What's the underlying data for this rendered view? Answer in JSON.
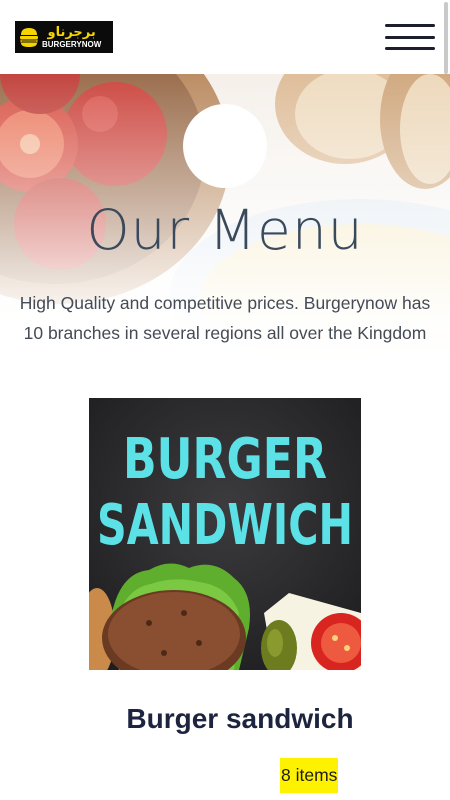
{
  "header": {
    "logo": {
      "arabic": "برجرناو",
      "english": "BURGERYNOW"
    },
    "menu_icon": "hamburger-menu-icon"
  },
  "hero": {
    "title": "Our Menu",
    "description": "High Quality and competitive prices. Burgerynow has 10 branches in several regions all over the Kingdom"
  },
  "category": {
    "image_text_line1": "BURGER",
    "image_text_line2": "SANDWICH",
    "title": "Burger sandwich",
    "count_label": "8 items"
  },
  "colors": {
    "badge": "#fff200",
    "title_text": "#1d2440",
    "image_text": "#5ce1e6",
    "logo_bg": "#0b0b0b",
    "logo_accent": "#f5d400"
  }
}
